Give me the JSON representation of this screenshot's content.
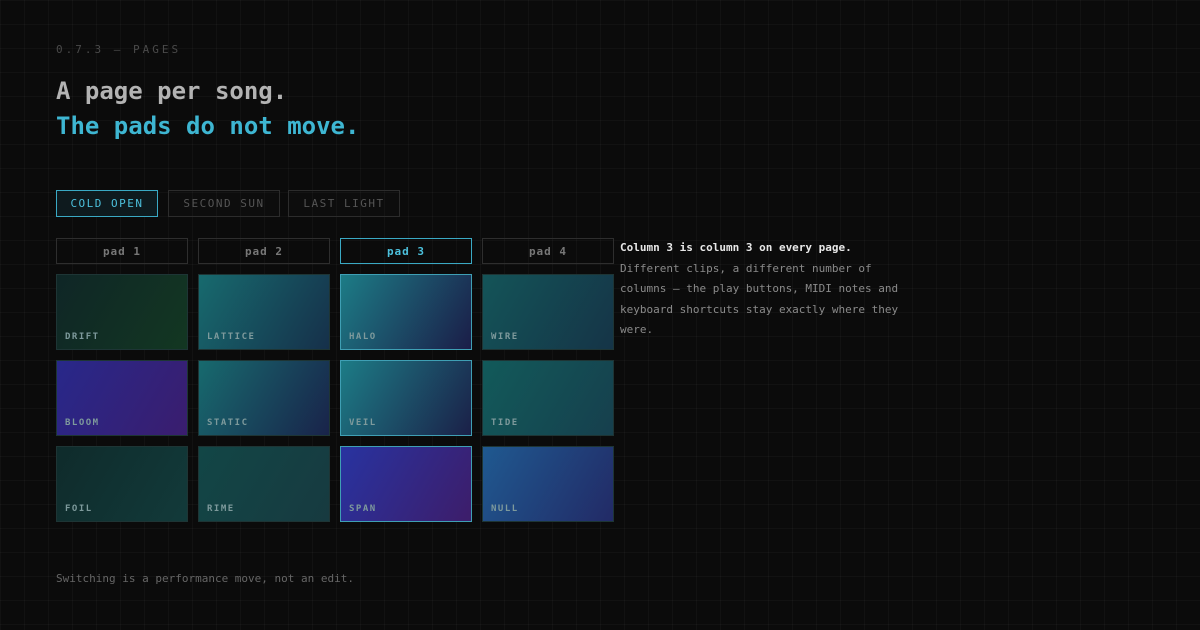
{
  "header": {
    "version": "0.7.3 — PAGES",
    "title_line1": "A page per song.",
    "title_line2": "The pads do not move."
  },
  "tabs": [
    {
      "label": "COLD OPEN",
      "active": true
    },
    {
      "label": "SECOND SUN",
      "active": false
    },
    {
      "label": "LAST LIGHT",
      "active": false
    }
  ],
  "columns": [
    {
      "label": "pad 1",
      "active": false
    },
    {
      "label": "pad 2",
      "active": false
    },
    {
      "label": "pad 3",
      "active": true
    },
    {
      "label": "pad 4",
      "active": false
    }
  ],
  "pads": [
    [
      {
        "name": "DRIFT",
        "colors": [
          "#0f2626",
          "#133722"
        ],
        "highlighted": false
      },
      {
        "name": "LATTICE",
        "colors": [
          "#176a6e",
          "#16304a"
        ],
        "highlighted": false
      },
      {
        "name": "HALO",
        "colors": [
          "#1c7c86",
          "#1b1d48"
        ],
        "highlighted": true
      },
      {
        "name": "WIRE",
        "colors": [
          "#145458",
          "#153447"
        ],
        "highlighted": false
      }
    ],
    [
      {
        "name": "BLOOM",
        "colors": [
          "#28288a",
          "#3a1d6e"
        ],
        "highlighted": false
      },
      {
        "name": "STATIC",
        "colors": [
          "#176a6e",
          "#19234a"
        ],
        "highlighted": false
      },
      {
        "name": "VEIL",
        "colors": [
          "#1c7c86",
          "#1b2048"
        ],
        "highlighted": true
      },
      {
        "name": "TIDE",
        "colors": [
          "#125a5a",
          "#163f4d"
        ],
        "highlighted": false
      }
    ],
    [
      {
        "name": "FOIL",
        "colors": [
          "#0f2b2b",
          "#123a3a"
        ],
        "highlighted": false
      },
      {
        "name": "RIME",
        "colors": [
          "#124646",
          "#173a40"
        ],
        "highlighted": false
      },
      {
        "name": "SPAN",
        "colors": [
          "#2833a0",
          "#3d1d6a"
        ],
        "highlighted": true
      },
      {
        "name": "NULL",
        "colors": [
          "#1f5990",
          "#222a66"
        ],
        "highlighted": false
      }
    ]
  ],
  "description": {
    "strong": "Column 3 is column 3 on every page.",
    "body": " Different clips, a different number of columns — the play buttons, MIDI notes and keyboard shortcuts stay exactly where they were."
  },
  "footer": "Switching is a performance move, not an edit."
}
